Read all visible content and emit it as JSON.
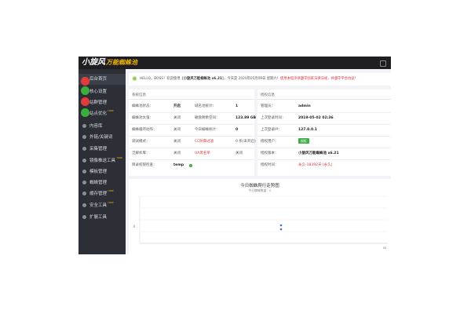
{
  "header": {
    "logo_main": "小旋风",
    "logo_sub": "万能蜘蛛池"
  },
  "sidebar": {
    "items": [
      {
        "label": "后台首页",
        "icon": "home-icon",
        "new": ""
      },
      {
        "label": "核心设置",
        "icon": "gear-icon",
        "new": ""
      },
      {
        "label": "站群管理",
        "icon": "sites-icon",
        "new": ""
      },
      {
        "label": "站点优化",
        "icon": "optimize-icon",
        "new": "new"
      },
      {
        "label": "内容库",
        "icon": "content-icon",
        "new": ""
      },
      {
        "label": "外链/关键词",
        "icon": "link-icon",
        "new": ""
      },
      {
        "label": "采集管理",
        "icon": "collect-icon",
        "new": ""
      },
      {
        "label": "镜像推送工具",
        "icon": "push-icon",
        "new": "new"
      },
      {
        "label": "模板管理",
        "icon": "template-icon",
        "new": ""
      },
      {
        "label": "蜘蛛管理",
        "icon": "spider-icon",
        "new": ""
      },
      {
        "label": "缓存管理",
        "icon": "cache-icon",
        "new": "new"
      },
      {
        "label": "安全工具",
        "icon": "shield-icon",
        "new": "new"
      },
      {
        "label": "扩展工具",
        "icon": "tools-icon",
        "new": ""
      }
    ]
  },
  "welcome": {
    "prefix": "HELLO，BOSS！欢迎使用【",
    "product": "小旋风万能蜘蛛池 x6.21",
    "mid": "】，今天是 2020年05月09日 星期六！",
    "warning": "使用本程序请遵守国家法律法规，并遵守平台协议！"
  },
  "system_panel": {
    "title": "系统信息",
    "rows": [
      {
        "l1": "蜘蛛池状态：",
        "v1": "开启",
        "l2": "域名池统计：",
        "v2": "1"
      },
      {
        "l1": "蜘蛛池太强：",
        "v1": "关闭",
        "l2": "磁盘剩余空间：",
        "v2": "123.89 GB"
      },
      {
        "l1": "蜘蛛循环动作：",
        "v1": "关闭",
        "l2": "今日蜘蛛统计：",
        "v2": "0"
      },
      {
        "l1": "调试模式：",
        "v1": "关闭",
        "l2": "CC防御过滤",
        "v2": "0 条(未开启)"
      },
      {
        "l1": "泛解析库：",
        "v1": "关闭",
        "l2": "UA黑名单",
        "v2": "关闭"
      },
      {
        "l1": "目录权限检查：",
        "v1": "temp",
        "l2": "",
        "v2": ""
      }
    ]
  },
  "auth_panel": {
    "title": "授权信息",
    "rows": [
      {
        "label": "管理员：",
        "value": "admin"
      },
      {
        "label": "上次登录时间：",
        "value": "2019-05-02 02:36"
      },
      {
        "label": "上次登录IP：",
        "value": "127.0.0.1"
      },
      {
        "label": "授权用户：",
        "value": "授权"
      },
      {
        "label": "授权版本：",
        "value": "小旋风万能蜘蛛池 x6.21"
      },
      {
        "label": "授权时间：",
        "value": "永久-18392天 (永久)"
      }
    ]
  },
  "chart_data": {
    "type": "line",
    "title": "今日蜘蛛爬行走势图",
    "subtitle": "今日蜘蛛数量：0",
    "x": [
      "00"
    ],
    "series": [
      {
        "values": [
          0
        ]
      }
    ],
    "ytick": "0",
    "xtick": "00",
    "legend": "top-right",
    "grid": true
  },
  "colors": {
    "sidebar_bg": "#2c2f36",
    "header_bg": "#1e1e22",
    "accent_red": "#d9373d",
    "accent_green": "#3fae49",
    "logo_yellow": "#f0b400"
  }
}
